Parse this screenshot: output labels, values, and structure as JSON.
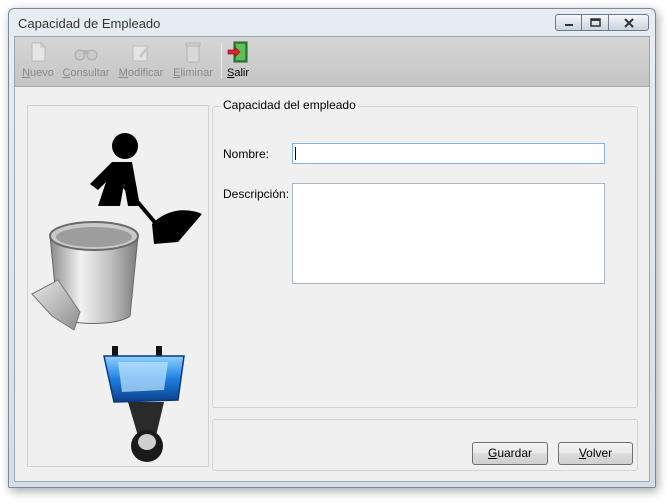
{
  "window": {
    "title": "Capacidad de Empleado"
  },
  "toolbar": {
    "items": [
      {
        "label": "Nuevo",
        "mnemonic": "N",
        "rest": "uevo",
        "enabled": false,
        "icon": "new-document-icon"
      },
      {
        "label": "Consultar",
        "mnemonic": "C",
        "rest": "onsultar",
        "enabled": false,
        "icon": "binoculars-icon"
      },
      {
        "label": "Modificar",
        "mnemonic": "M",
        "rest": "odificar",
        "enabled": false,
        "icon": "edit-icon"
      },
      {
        "label": "Eliminar",
        "mnemonic": "E",
        "rest": "liminar",
        "enabled": false,
        "icon": "trash-icon"
      },
      {
        "label": "Salir",
        "mnemonic": "S",
        "rest": "alir",
        "enabled": true,
        "icon": "exit-door-icon"
      }
    ]
  },
  "illustration": {
    "icons": [
      "worker-with-shovel-icon",
      "paint-bucket-icon",
      "pipe-wrench-tool-icon"
    ]
  },
  "form": {
    "group_title": "Capacidad del empleado",
    "nombre_label": "Nombre:",
    "nombre_value": "",
    "descripcion_label": "Descripción:",
    "descripcion_value": ""
  },
  "buttons": {
    "guardar": {
      "mnemonic": "G",
      "rest": "uardar"
    },
    "volver": {
      "mnemonic": "V",
      "rest": "olver"
    }
  },
  "colors": {
    "accent_blue": "#1e7fe0",
    "exit_red": "#d9262b",
    "exit_green": "#2e8b3a"
  }
}
